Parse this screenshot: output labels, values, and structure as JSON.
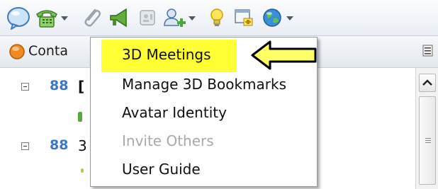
{
  "toolbar": {
    "icons": [
      "chat-bubble-icon",
      "phone-icon",
      "paperclip-icon",
      "megaphone-icon",
      "contact-card-icon",
      "add-user-icon",
      "lightbulb-icon",
      "window-add-icon",
      "globe-icon"
    ]
  },
  "panel": {
    "header_label": "Conta",
    "tree": [
      {
        "count_label": "88",
        "name": "["
      },
      {
        "count_label": "88",
        "name": "3"
      }
    ]
  },
  "menu": {
    "items": [
      {
        "label": "3D Meetings",
        "state": "highlighted"
      },
      {
        "label": "Manage 3D Bookmarks",
        "state": "normal"
      },
      {
        "label": "Avatar Identity",
        "state": "normal"
      },
      {
        "label": "Invite Others",
        "state": "disabled"
      },
      {
        "label": "User Guide",
        "state": "normal"
      }
    ]
  },
  "colors": {
    "highlight": "#ffff33",
    "disabled_text": "#a9a9a9",
    "callout_arrow": "#ffff66"
  }
}
